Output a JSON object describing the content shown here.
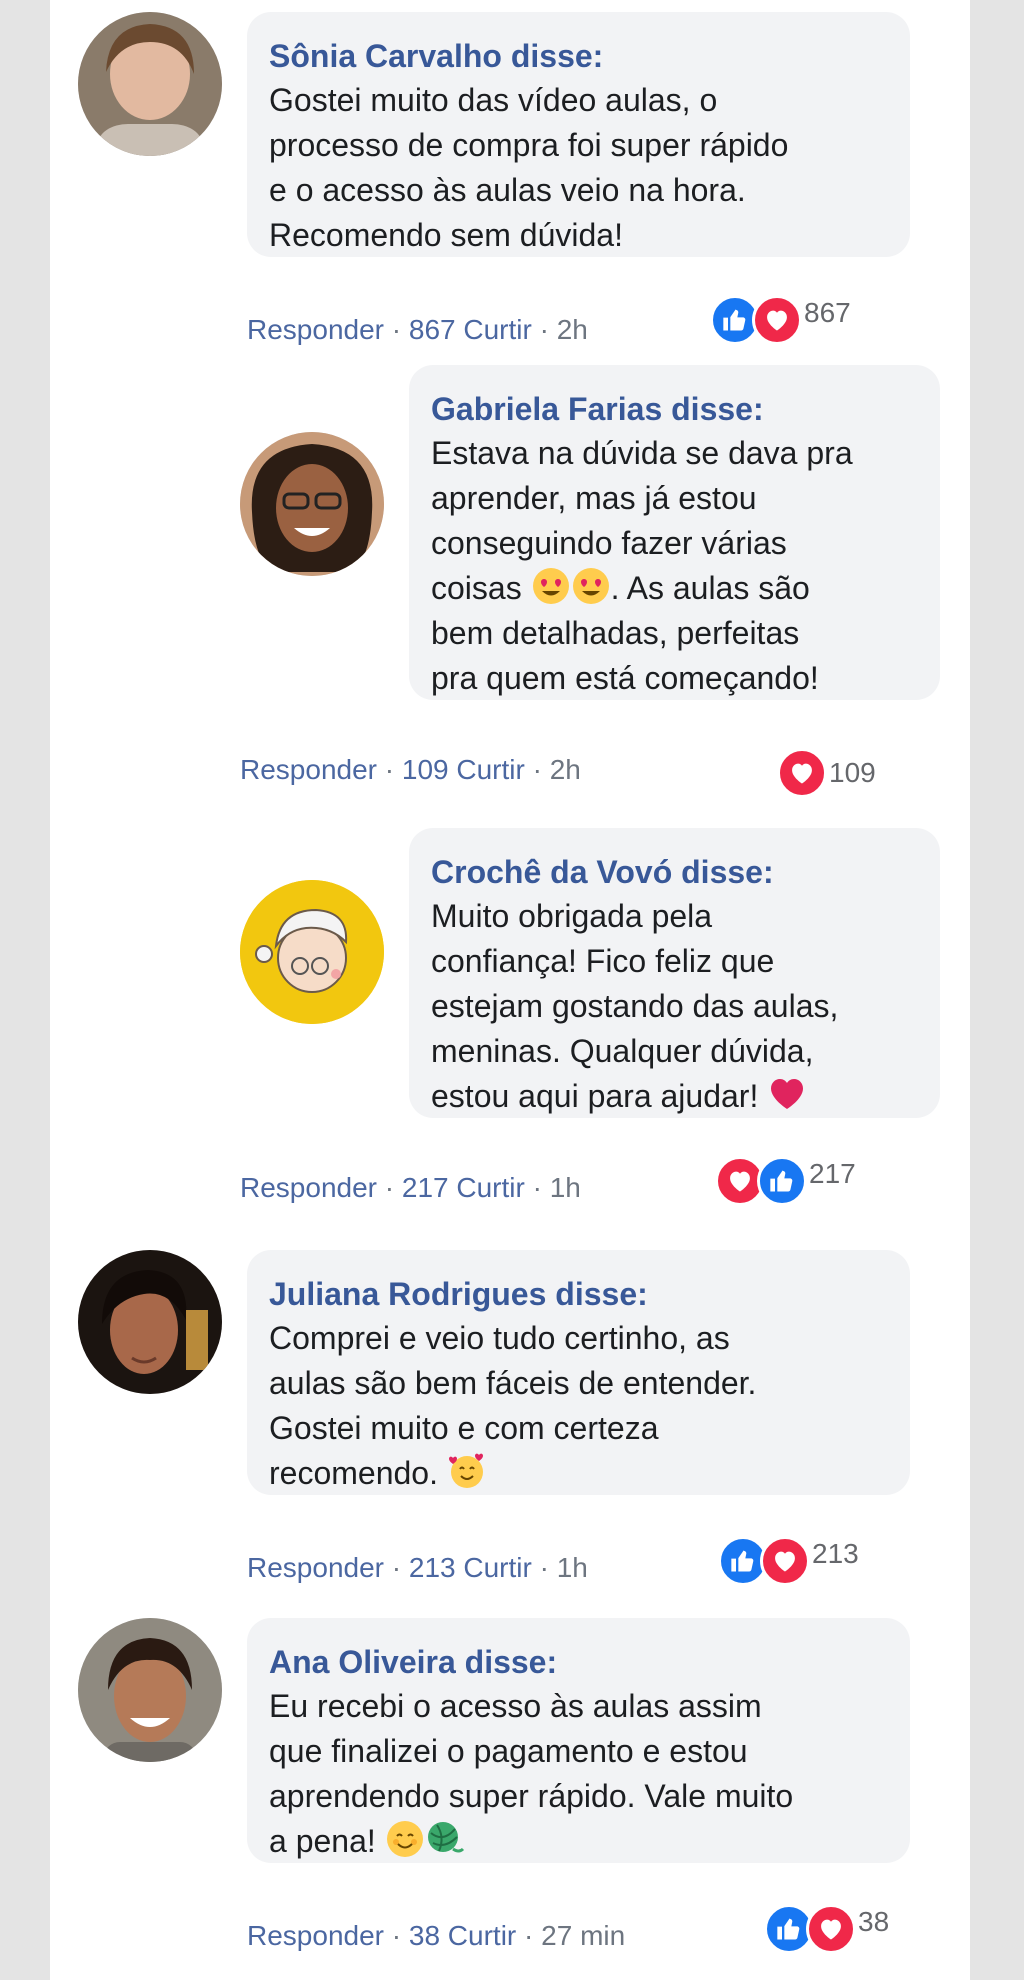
{
  "comments": [
    {
      "author": "Sônia Carvalho disse:",
      "lines": [
        "Gostei muito das vídeo aulas, o",
        "processo de compra foi super rápido",
        "e o acesso às aulas veio na hora.",
        "Recomendo sem dúvida!"
      ],
      "reply": "Responder",
      "likes": "867 Curtir",
      "time": "2h",
      "reaction_count": "867",
      "reactions": [
        "like",
        "love"
      ]
    },
    {
      "author": "Gabriela Farias disse:",
      "lines": [
        "Estava na dúvida se dava pra",
        "aprender, mas já estou",
        "conseguindo fazer várias",
        "coisas",
        ". As aulas são",
        "bem detalhadas, perfeitas",
        "pra quem está começando!"
      ],
      "reply": "Responder",
      "likes": "109 Curtir",
      "time": "2h",
      "reaction_count": "109",
      "reactions": [
        "love"
      ]
    },
    {
      "author": "Crochê da Vovó disse:",
      "lines": [
        "Muito obrigada pela",
        "confiança! Fico feliz que",
        "estejam gostando das aulas,",
        "meninas. Qualquer dúvida,",
        "estou aqui para ajudar!"
      ],
      "reply": "Responder",
      "likes": "217 Curtir",
      "time": "1h",
      "reaction_count": "217",
      "reactions": [
        "love",
        "like"
      ]
    },
    {
      "author": "Juliana Rodrigues disse:",
      "lines": [
        "Comprei e veio tudo certinho, as",
        "aulas são bem fáceis de entender.",
        "Gostei muito e com certeza",
        "recomendo."
      ],
      "reply": "Responder",
      "likes": "213 Curtir",
      "time": "1h",
      "reaction_count": "213",
      "reactions": [
        "like",
        "love"
      ]
    },
    {
      "author": "Ana Oliveira disse:",
      "lines": [
        "Eu recebi o acesso às aulas assim",
        "que finalizei o pagamento e estou",
        "aprendendo super rápido. Vale muito",
        "a pena!"
      ],
      "reply": "Responder",
      "likes": "38 Curtir",
      "time": "27 min",
      "reaction_count": "38",
      "reactions": [
        "like",
        "love"
      ]
    }
  ],
  "separator": "·",
  "colors": {
    "author": "#385898",
    "meta": "#4b67a1",
    "like": "#1877f2",
    "love": "#f02849",
    "bubble": "#f2f3f5"
  }
}
